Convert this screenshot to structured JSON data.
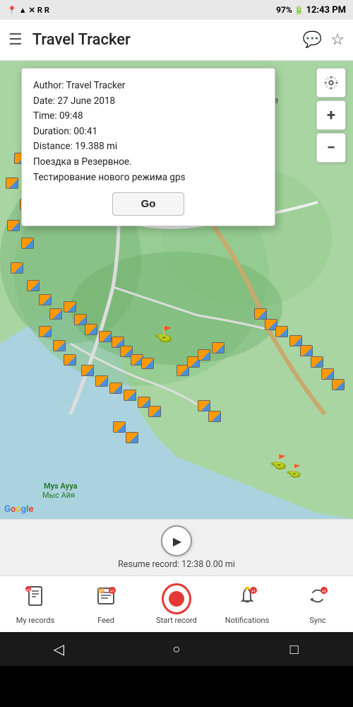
{
  "statusBar": {
    "leftIcons": "📍▲ ✕ R R",
    "battery": "97%",
    "time": "12:43 PM"
  },
  "topBar": {
    "title": "Travel Tracker",
    "hamburgerIcon": "☰",
    "chatIcon": "💬",
    "starIcon": "☆"
  },
  "popup": {
    "author": "Author: Travel Tracker",
    "date": "Date: 27 June 2018",
    "time": "Time: 09:48",
    "duration": "Duration: 00:41",
    "distance": "Distance: 19.388 mi",
    "note1": "Поездка в Резервное.",
    "note2": "Тестирование нового режима gps",
    "goButton": "Go"
  },
  "mapControls": {
    "locateIcon": "⊕",
    "zoomIn": "+",
    "zoomOut": "−"
  },
  "resumeBar": {
    "playIcon": "▶",
    "resumeText": "Resume record: 12:38 0.00 mi"
  },
  "bottomNav": {
    "items": [
      {
        "id": "my-records",
        "label": "My records",
        "icon": "🗺",
        "badge": "+1",
        "hasBadge": true
      },
      {
        "id": "feed",
        "label": "Feed",
        "icon": "📰",
        "badge": "+1",
        "hasBadge": true
      },
      {
        "id": "start-record",
        "label": "Start record",
        "icon": "record",
        "badge": "",
        "hasBadge": false
      },
      {
        "id": "notifications",
        "label": "Notifications",
        "icon": "🔔",
        "badge": "+1",
        "hasBadge": true
      },
      {
        "id": "sync",
        "label": "Sync",
        "icon": "🔄",
        "badge": "+1",
        "hasBadge": true
      }
    ]
  },
  "androidNav": {
    "backIcon": "◁",
    "homeIcon": "○",
    "recentsIcon": "□"
  },
  "mapText": {
    "gончарное": "Гончарное",
    "mysAyya": "Mys Ayya",
    "mysAyyaCyrillic": "Мыс Айя"
  }
}
